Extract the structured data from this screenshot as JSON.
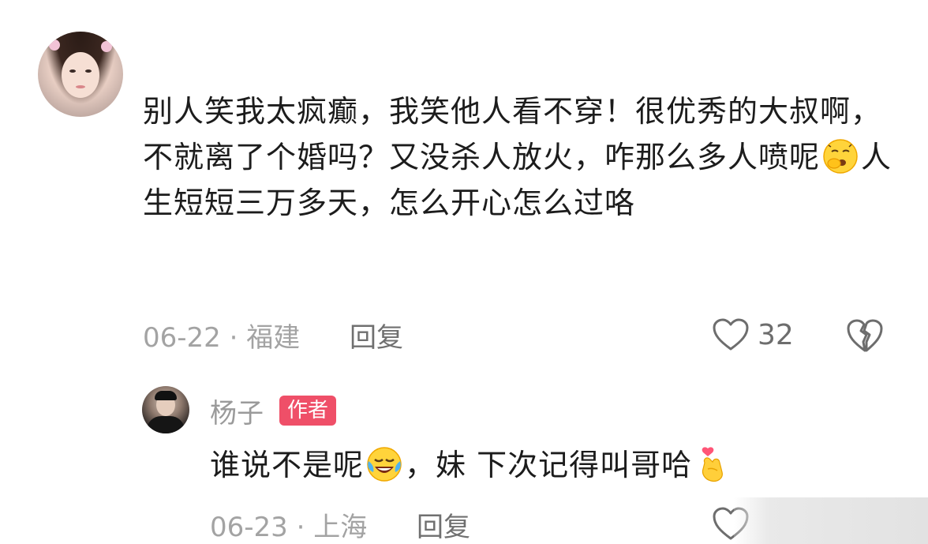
{
  "comment": {
    "text_part1": "别人笑我太疯癫，我笑他人看不穿！很优秀的大叔啊，不就离了个婚吗？又没杀人放火，咋那么多人喷呢",
    "text_part2": "人生短短三万多天，怎么开心怎么过咯",
    "emoji": "yawning-face-emoji",
    "date": "06-22",
    "separator": "·",
    "location": "福建",
    "reply_label": "回复",
    "like_count": "32",
    "like_icon": "heart-outline-icon",
    "dislike_icon": "broken-heart-icon"
  },
  "reply": {
    "author": "杨子",
    "badge": "作者",
    "text_part1": "谁说不是呢",
    "text_part2": "，妹 下次记得叫哥哈",
    "emoji1": "laughing-crying-emoji",
    "emoji2": "finger-heart-emoji",
    "date": "06-23",
    "separator": "·",
    "location": "上海",
    "reply_label": "回复",
    "like_icon": "heart-outline-icon"
  },
  "colors": {
    "badge": "#ef4f68",
    "meta_text": "#a3a3a3",
    "body_text": "#1c1c1c"
  }
}
